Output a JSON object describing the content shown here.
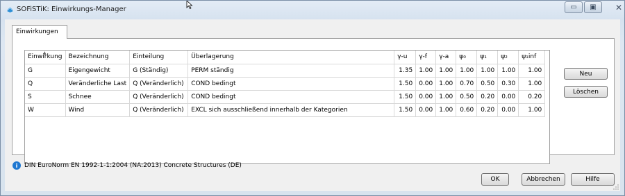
{
  "window": {
    "title": "SOFiSTiK: Einwirkungs-Manager",
    "caption_buttons": {
      "minimize": "▭",
      "maximize": "▣",
      "close": "✕"
    }
  },
  "tabs": [
    {
      "label": "Einwirkungen"
    }
  ],
  "table": {
    "columns": [
      "Einwirkung",
      "Bezeichnung",
      "Einteilung",
      "Überlagerung",
      "γ-u",
      "γ-f",
      "γ-a",
      "ψ₀",
      "ψ₁",
      "ψ₂",
      "ψ₁inf"
    ],
    "rows": [
      [
        "G",
        "Eigengewicht",
        "G (Ständig)",
        "PERM ständig",
        "1.35",
        "1.00",
        "1.00",
        "1.00",
        "1.00",
        "1.00",
        "1.00"
      ],
      [
        "Q",
        "Veränderliche Last",
        "Q (Veränderlich)",
        "COND bedingt",
        "1.50",
        "0.00",
        "1.00",
        "0.70",
        "0.50",
        "0.30",
        "1.00"
      ],
      [
        "S",
        "Schnee",
        "Q (Veränderlich)",
        "COND bedingt",
        "1.50",
        "0.00",
        "1.00",
        "0.50",
        "0.20",
        "0.00",
        "0.20"
      ],
      [
        "W",
        "Wind",
        "Q (Veränderlich)",
        "EXCL sich ausschließend innerhalb der Kategorien",
        "1.50",
        "0.00",
        "1.00",
        "0.60",
        "0.20",
        "0.00",
        "1.00"
      ]
    ]
  },
  "side_buttons": {
    "new": "Neu",
    "delete": "Löschen"
  },
  "info": {
    "text": "DIN EuroNorm EN 1992-1-1:2004 (NA:2013) Concrete Structures (DE)"
  },
  "bottom_buttons": {
    "ok": "OK",
    "cancel": "Abbrechen",
    "help": "Hilfe"
  },
  "icons": {
    "app_icon": "sofistik-logo-icon",
    "info_icon": "info-icon",
    "cursor": "mouse-cursor-icon"
  },
  "colors": {
    "accent": "#1f78d1",
    "title_bg": "#dde7f2",
    "border": "#a0a0a0"
  }
}
